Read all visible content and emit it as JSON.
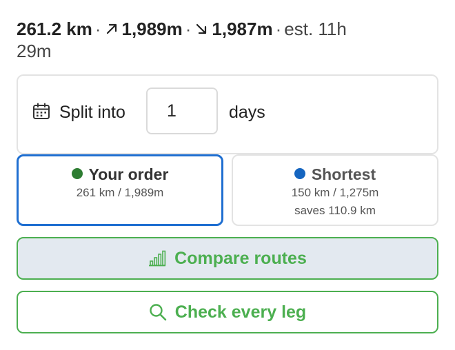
{
  "summary": {
    "distance": "261.2 km",
    "sep1": "·",
    "ascent": "1,989m",
    "sep2": "·",
    "descent": "1,987m",
    "sep3": "·",
    "estimate_line1": "est. 11h",
    "estimate_line2": "29m",
    "ascent_icon": "arrow-up-right-icon",
    "descent_icon": "arrow-down-right-icon"
  },
  "split": {
    "icon": "calendar-icon",
    "label": "Split into",
    "days_value": "1",
    "days_label": "days"
  },
  "orders": {
    "your_order": {
      "title": "Your order",
      "color": "#2e7d32",
      "stats": "261 km / 1,989m",
      "selected": true
    },
    "shortest": {
      "title": "Shortest",
      "color": "#1565c0",
      "stats": "150 km / 1,275m",
      "saves": "saves 110.9 km",
      "selected": false
    }
  },
  "actions": {
    "compare_label": "Compare routes",
    "compare_icon": "bar-chart-icon",
    "check_label": "Check every leg",
    "check_icon": "search-icon",
    "accent": "#4caf50",
    "compare_bg": "#e3e9f0"
  }
}
